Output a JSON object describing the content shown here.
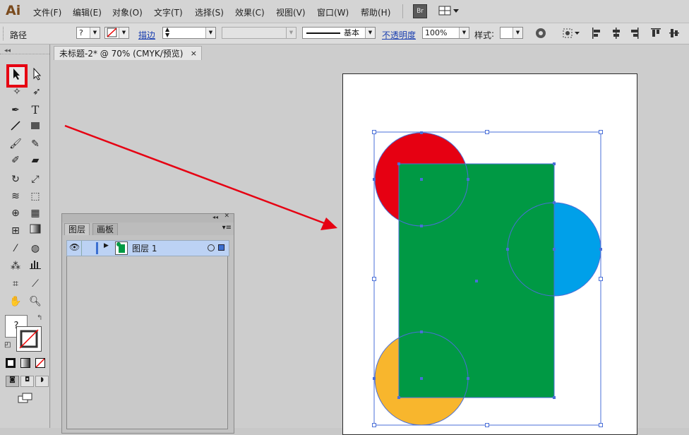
{
  "app": {
    "logo": "Ai"
  },
  "menu": [
    "文件(F)",
    "编辑(E)",
    "对象(O)",
    "文字(T)",
    "选择(S)",
    "效果(C)",
    "视图(V)",
    "窗口(W)",
    "帮助(H)"
  ],
  "menu_extras": {
    "bridge": "Br"
  },
  "controlbar": {
    "selection_type": "路径",
    "fill_value": "?",
    "stroke_label": "描边",
    "stroke_style": "基本",
    "opacity_label": "不透明度",
    "opacity_value": "100%",
    "style_label": "样式"
  },
  "document": {
    "tab_title": "未标题-2* @ 70% (CMYK/预览)",
    "close": "×"
  },
  "fill_swatch": {
    "value": "?"
  },
  "layers_panel": {
    "tabs": [
      "图层",
      "画板"
    ],
    "layer_name": "图层 1"
  },
  "artwork": {
    "colors": {
      "red": "#e60012",
      "green": "#009944",
      "blue": "#00a0e9",
      "orange": "#f8b62d",
      "selection": "#4a6fd8",
      "arrow": "#e60012"
    }
  }
}
